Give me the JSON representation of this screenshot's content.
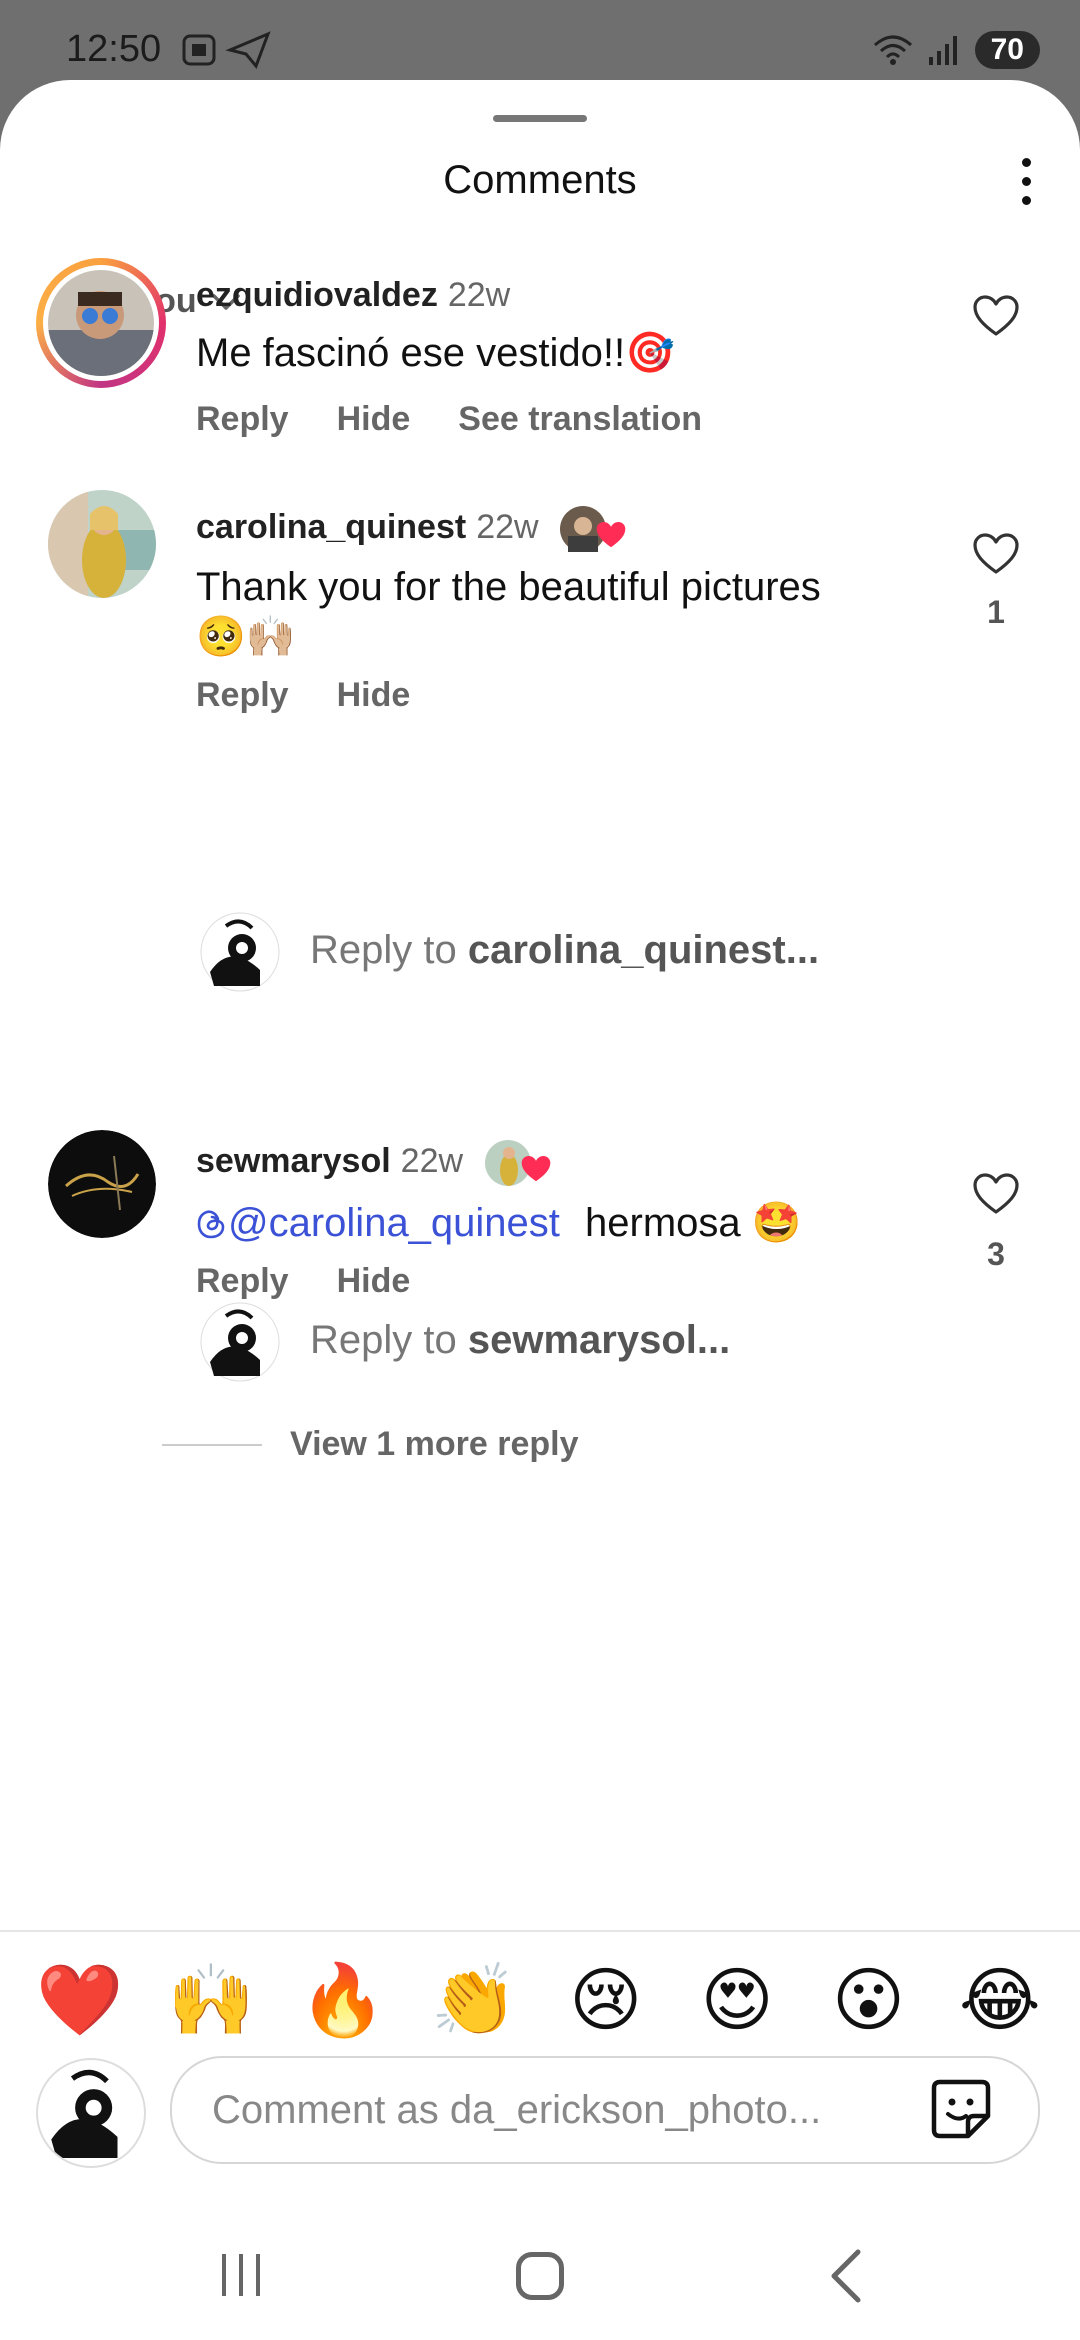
{
  "status_bar": {
    "time": "12:50",
    "battery": "70"
  },
  "sheet": {
    "title": "Comments"
  },
  "filter": {
    "label": "For you"
  },
  "comments": [
    {
      "username": "ezquidiovaldez",
      "time": "22w",
      "text": "Me fascinó ese vestido!!🎯",
      "actions": [
        "Reply",
        "Hide",
        "See translation"
      ],
      "likes": ""
    },
    {
      "username": "carolina_quinest",
      "time": "22w",
      "text_line1": "Thank you for the beautiful pictures",
      "text_line2": "🥺🙌🏼",
      "actions": [
        "Reply",
        "Hide"
      ],
      "likes": "1"
    },
    {
      "username": "sewmarysol",
      "time": "22w",
      "mention": "@carolina_quinest",
      "text": "hermosa 🤩",
      "actions": [
        "Reply",
        "Hide"
      ],
      "likes": "3"
    }
  ],
  "reply_prompts": [
    {
      "prefix": "Reply to ",
      "username": "carolina_quinest..."
    },
    {
      "prefix": "Reply to ",
      "username": "sewmarysol..."
    }
  ],
  "view_more": {
    "label": "View 1 more reply"
  },
  "emoji_bar": [
    "❤️",
    "🙌",
    "🔥",
    "👏",
    "😢",
    "😍",
    "😮",
    "😂"
  ],
  "composer": {
    "placeholder": "Comment as da_erickson_photo..."
  },
  "colors": {
    "mention": "#3b52d6",
    "like_red": "#ff2d55"
  }
}
